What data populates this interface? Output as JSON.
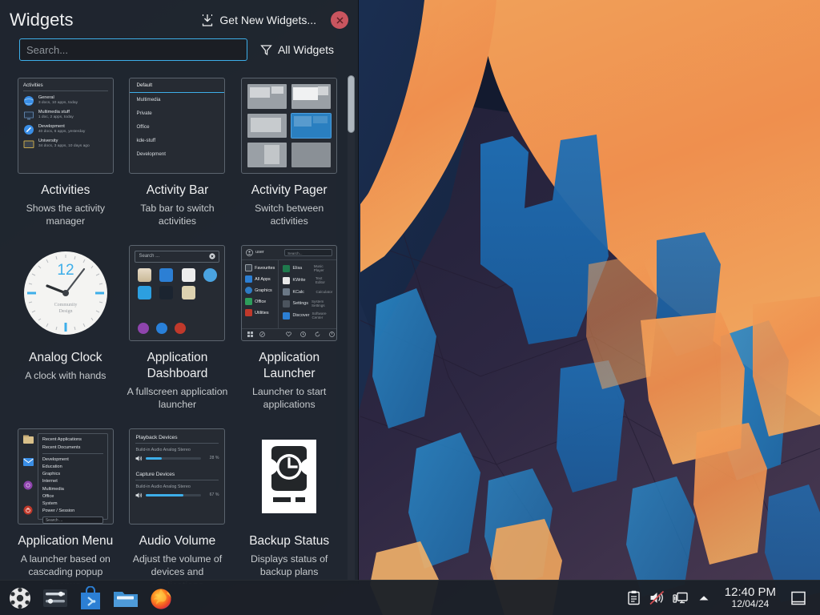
{
  "explorer": {
    "title": "Widgets",
    "get_new_widgets_label": "Get New Widgets...",
    "get_new_widgets_icon": "download-icon",
    "close_icon": "close-icon",
    "search": {
      "placeholder": "Search...",
      "value": ""
    },
    "filter": {
      "label": "All Widgets",
      "icon": "funnel-icon"
    },
    "accent_color": "#3daee9",
    "panel_bg": "#202630",
    "text_color": "#eff0f1"
  },
  "widgets": [
    {
      "name": "Activities",
      "description": "Shows the activity manager",
      "preview": {
        "type": "activities",
        "header": "Activities",
        "rows": [
          {
            "name": "General",
            "sub": "3 docs, 10 apps, today",
            "icon": "globe-icon",
            "color": "#3a8ee6"
          },
          {
            "name": "Multimedia stuff",
            "sub": "1 doc, 2 apps, today",
            "icon": "monitor-icon",
            "color": "#5d7fa6"
          },
          {
            "name": "Development",
            "sub": "40 docs, 6 apps, yesterday",
            "icon": "pen-icon",
            "color": "#3a8ee6"
          },
          {
            "name": "University",
            "sub": "34 docs, 3 apps, 10 days ago",
            "icon": "folder-icon",
            "color": "#c8a84b"
          }
        ]
      }
    },
    {
      "name": "Activity Bar",
      "description": "Tab bar to switch activities",
      "preview": {
        "type": "activity-bar",
        "items": [
          "Default",
          "Multimedia",
          "Private",
          "Office",
          "kde-stuff",
          "Development"
        ],
        "selected_index": 0
      }
    },
    {
      "name": "Activity Pager",
      "description": "Switch between activities",
      "preview": {
        "type": "pager",
        "cells": 6,
        "selected_index": 3,
        "selected_color": "#2a7fc0",
        "cell_color": "#9aa0a6"
      }
    },
    {
      "name": "Analog Clock",
      "description": "A clock with hands",
      "preview": {
        "type": "analog-clock",
        "hour_label": "12",
        "brand_line1": "Community",
        "brand_line2": "Design",
        "hour_hand_deg": -68,
        "minute_hand_deg": 22,
        "accent": "#3daee9"
      }
    },
    {
      "name": "Application Dashboard",
      "description": "A fullscreen application launcher",
      "preview": {
        "type": "dashboard",
        "search_placeholder": "Search ...",
        "clear_icon": "clear-icon",
        "icons": [
          {
            "name": "archive-icon",
            "color": "#e8dcc8"
          },
          {
            "name": "shopping-bag-icon",
            "color": "#2c7fd4"
          },
          {
            "name": "pdf-icon",
            "color": "#e8e8e8"
          },
          {
            "name": "settings-gear-icon",
            "color": "#4aa3e0"
          },
          {
            "name": "chat-icon",
            "color": "#2c9fe0"
          },
          {
            "name": "toggle-icon",
            "color": "#1b2430"
          },
          {
            "name": "document-icon",
            "color": "#ddd2b0"
          }
        ],
        "actions": [
          {
            "name": "lock-icon",
            "color": "#8e44ad"
          },
          {
            "name": "logout-icon",
            "color": "#2980d9"
          },
          {
            "name": "power-icon",
            "color": "#c0392b"
          }
        ]
      }
    },
    {
      "name": "Application Launcher",
      "description": "Launcher to start applications",
      "preview": {
        "type": "launcher",
        "user_label": "user",
        "search_placeholder": "Search...",
        "categories": [
          {
            "label": "Favourites",
            "color": "#3a424c"
          },
          {
            "label": "All Apps",
            "color": "#2c7fd4"
          },
          {
            "label": "Graphics",
            "color": "#2e7bc4"
          },
          {
            "label": "Office",
            "color": "#2e9e5b"
          },
          {
            "label": "Utilities",
            "color": "#c0392b"
          }
        ],
        "apps": [
          {
            "name": "Elisa",
            "desc": "Music Player",
            "color": "#1f7a4d"
          },
          {
            "name": "KWrite",
            "desc": "Text Editor",
            "color": "#e8e8e8"
          },
          {
            "name": "KCalc",
            "desc": "Calculator",
            "color": "#6b7886"
          },
          {
            "name": "Settings",
            "desc": "System Settings",
            "color": "#4c545e"
          },
          {
            "name": "Discover",
            "desc": "Software Center",
            "color": "#2c7fd4"
          }
        ],
        "footer_left_icons": [
          "grid-icon",
          "compass-icon"
        ],
        "footer_right_icons": [
          "favorite-icon",
          "history-icon",
          "restart-icon",
          "power-icon"
        ]
      }
    },
    {
      "name": "Application Menu",
      "description": "A launcher based on cascading popup menus",
      "preview": {
        "type": "app-menu",
        "side_icons": [
          {
            "name": "files-icon",
            "color": "#d9c08a"
          },
          {
            "name": "mail-icon",
            "color": "#3a8ee6"
          },
          {
            "name": "lock-icon",
            "color": "#8e44ad"
          },
          {
            "name": "power-icon",
            "color": "#c0392b"
          }
        ],
        "top_items": [
          "Recent Applications",
          "Recent Documents"
        ],
        "items": [
          "Development",
          "Education",
          "Graphics",
          "Internet",
          "Multimedia",
          "Office",
          "System",
          "Power / Session"
        ],
        "search_placeholder": "Search ..."
      }
    },
    {
      "name": "Audio Volume",
      "description": "Adjust the volume of devices and applications",
      "preview": {
        "type": "audio-volume",
        "sections": [
          {
            "title": "Playback Devices",
            "device": "Build-in Audio Analog Stereo",
            "percent": 28,
            "percent_label": "28 %"
          },
          {
            "title": "Capture Devices",
            "device": "Build-in Audio Analog Stereo",
            "percent": 67,
            "percent_label": "67 %"
          }
        ],
        "slider_color": "#3daee9",
        "speaker_icon": "speaker-icon"
      }
    },
    {
      "name": "Backup Status",
      "description": "Displays status of backup plans",
      "preview": {
        "type": "backup",
        "icon": "backup-drive-clock-icon",
        "color": "#ffffff"
      }
    }
  ],
  "scrollbar": {
    "name": "vertical-scrollbar"
  },
  "taskbar": {
    "launchers": [
      {
        "name": "kubuntu-menu-icon",
        "label": "Application Launcher"
      },
      {
        "name": "system-settings-icon",
        "label": "System Settings"
      },
      {
        "name": "discover-icon",
        "label": "Discover"
      },
      {
        "name": "dolphin-file-manager-icon",
        "label": "Dolphin"
      },
      {
        "name": "firefox-icon",
        "label": "Firefox"
      }
    ],
    "tray": [
      {
        "name": "clipboard-icon"
      },
      {
        "name": "volume-muted-icon"
      },
      {
        "name": "network-display-icon"
      },
      {
        "name": "show-hidden-icons-arrow"
      }
    ],
    "clock": {
      "time": "12:40 PM",
      "date": "12/04/24"
    },
    "show_desktop": {
      "name": "show-desktop-button"
    }
  }
}
